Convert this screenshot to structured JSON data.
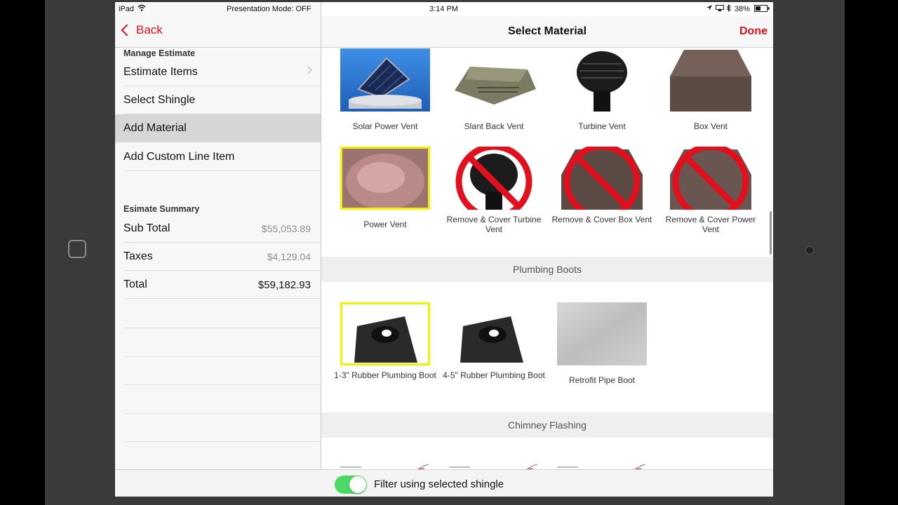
{
  "status_bar": {
    "device": "iPad",
    "presentation_mode": "Presentation Mode: OFF",
    "time": "3:14 PM",
    "battery": "38%"
  },
  "left_panel": {
    "back_label": "Back",
    "manage_header": "Manage Estimate",
    "menu_items": [
      {
        "label": "Estimate Items"
      },
      {
        "label": "Select Shingle"
      },
      {
        "label": "Add Material"
      },
      {
        "label": "Add Custom Line Item"
      }
    ],
    "summary_header": "Esimate Summary",
    "summary": [
      {
        "label": "Sub Total",
        "value": "$55,053.89"
      },
      {
        "label": "Taxes",
        "value": "$4,129.04"
      },
      {
        "label": "Total",
        "value": "$59,182.93"
      }
    ]
  },
  "right_panel": {
    "title": "Select Material",
    "done_label": "Done",
    "vents": [
      {
        "label": "Solar Power Vent"
      },
      {
        "label": "Slant Back Vent"
      },
      {
        "label": "Turbine Vent"
      },
      {
        "label": "Box Vent"
      },
      {
        "label": "Power Vent"
      },
      {
        "label": "Remove & Cover Turbine Vent"
      },
      {
        "label": "Remove & Cover Box Vent"
      },
      {
        "label": "Remove & Cover Power Vent"
      }
    ],
    "plumbing_header": "Plumbing Boots",
    "plumbing": [
      {
        "label": "1-3\" Rubber Plumbing Boot"
      },
      {
        "label": "4-5\" Rubber Plumbing Boot"
      },
      {
        "label": "Retrofit Pipe Boot"
      }
    ],
    "chimney_header": "Chimney Flashing"
  },
  "toolbar": {
    "filter_label": "Filter using selected shingle",
    "filter_on": true
  },
  "colors": {
    "accent": "#e0101e",
    "selection_highlight": "#f0f000",
    "toggle_on": "#4cd964"
  }
}
